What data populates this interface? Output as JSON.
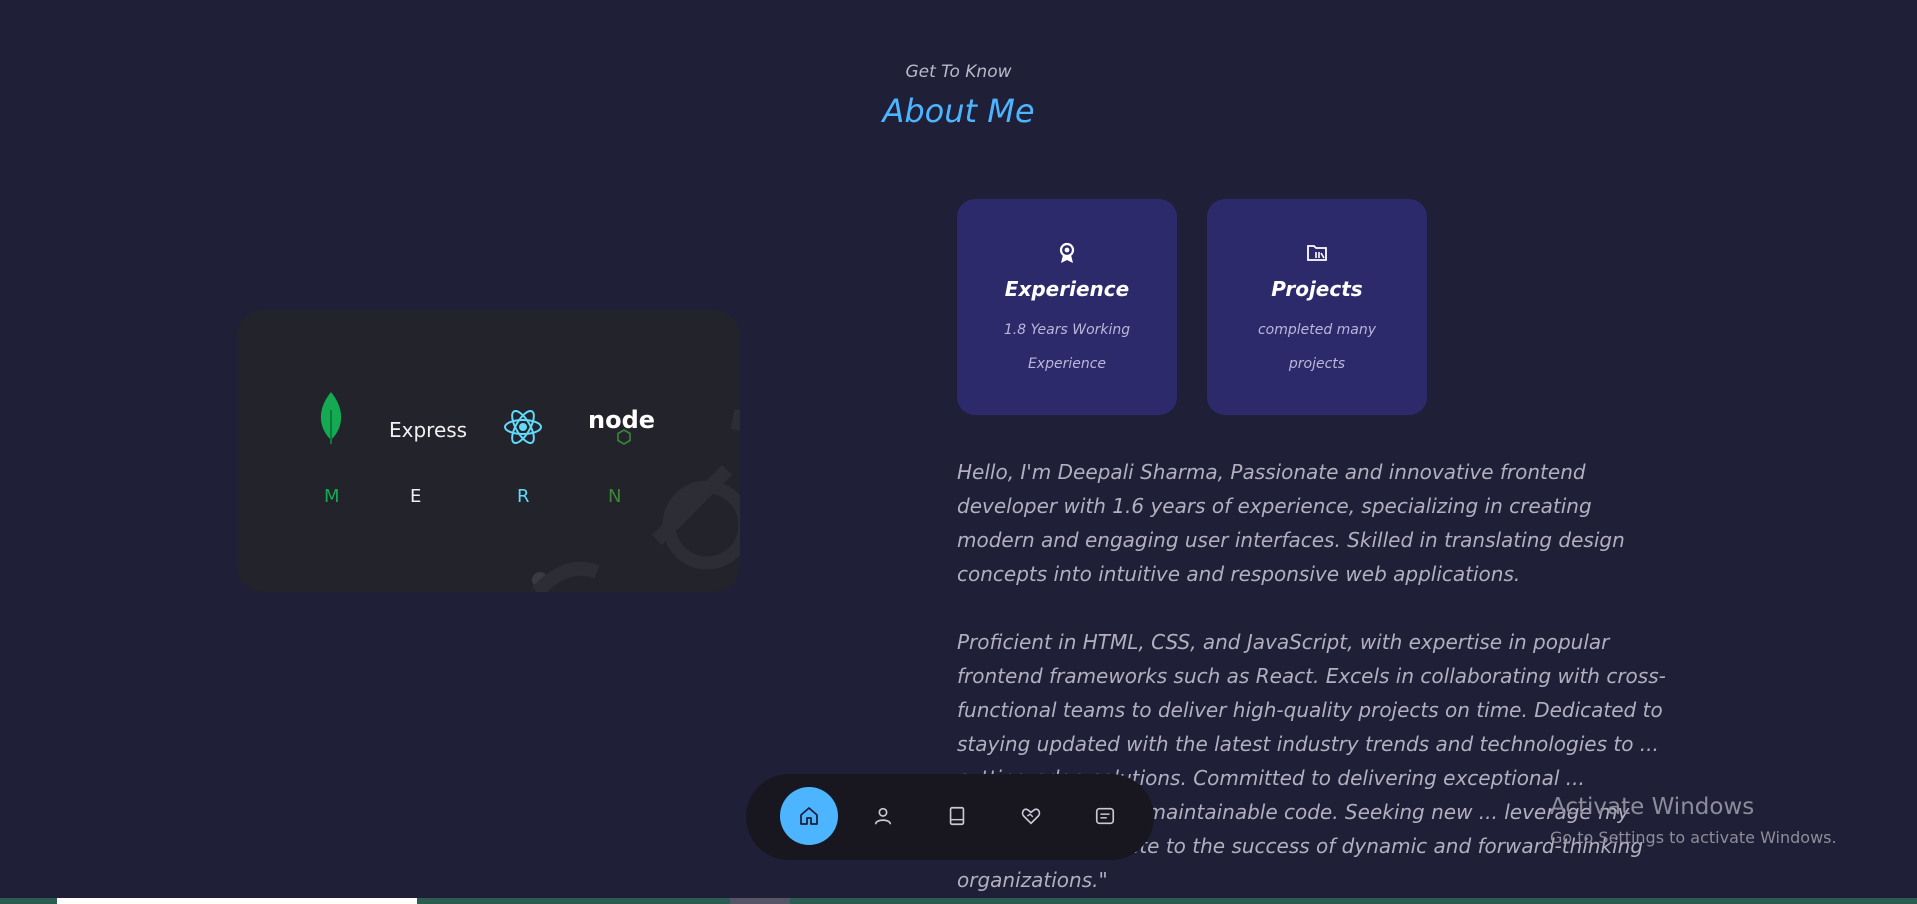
{
  "intro": {
    "subtitle": "Get To Know",
    "title": "About Me"
  },
  "stack": {
    "express_label": "Express",
    "letters": [
      "M",
      "E",
      "R",
      "N"
    ],
    "colors": {
      "mongo": "#13aa52",
      "express": "#f1f1f1",
      "react": "#61dafb",
      "node": "#3c873a"
    }
  },
  "cards": [
    {
      "icon": "award-icon",
      "title": "Experience",
      "desc_line1": "1.8 Years Working",
      "desc_line2": "Experience"
    },
    {
      "icon": "folder-icon",
      "title": "Projects",
      "desc_line1": "completed many",
      "desc_line2": "projects"
    }
  ],
  "bio": {
    "para1": "Hello, I'm Deepali Sharma, Passionate and innovative frontend developer with 1.6 years of experience, specializing in creating modern and engaging user interfaces. Skilled in translating design concepts into intuitive and responsive web applications.",
    "para2": "Proficient in HTML, CSS, and JavaScript, with expertise in popular frontend frameworks such as React. Excels in collaborating with cross-functional teams to deliver high-quality projects on time. Dedicated to staying updated with the latest industry trends and technologies to ... cutting-edge solutions. Committed to delivering exceptional ... through clean and maintainable code. Seeking new ... leverage my skills and contribute to the success of dynamic and forward-thinking organizations.\""
  },
  "dock": {
    "items": [
      "home-icon",
      "user-icon",
      "book-icon",
      "heart-handshake-icon",
      "message-icon"
    ],
    "active": "home-icon"
  },
  "watermark": {
    "title": "Activate Windows",
    "subtitle": "Go to Settings to activate Windows."
  },
  "theme": {
    "background": "#1f1f38",
    "accent": "#4db5ff",
    "card": "#2c2a6b"
  }
}
